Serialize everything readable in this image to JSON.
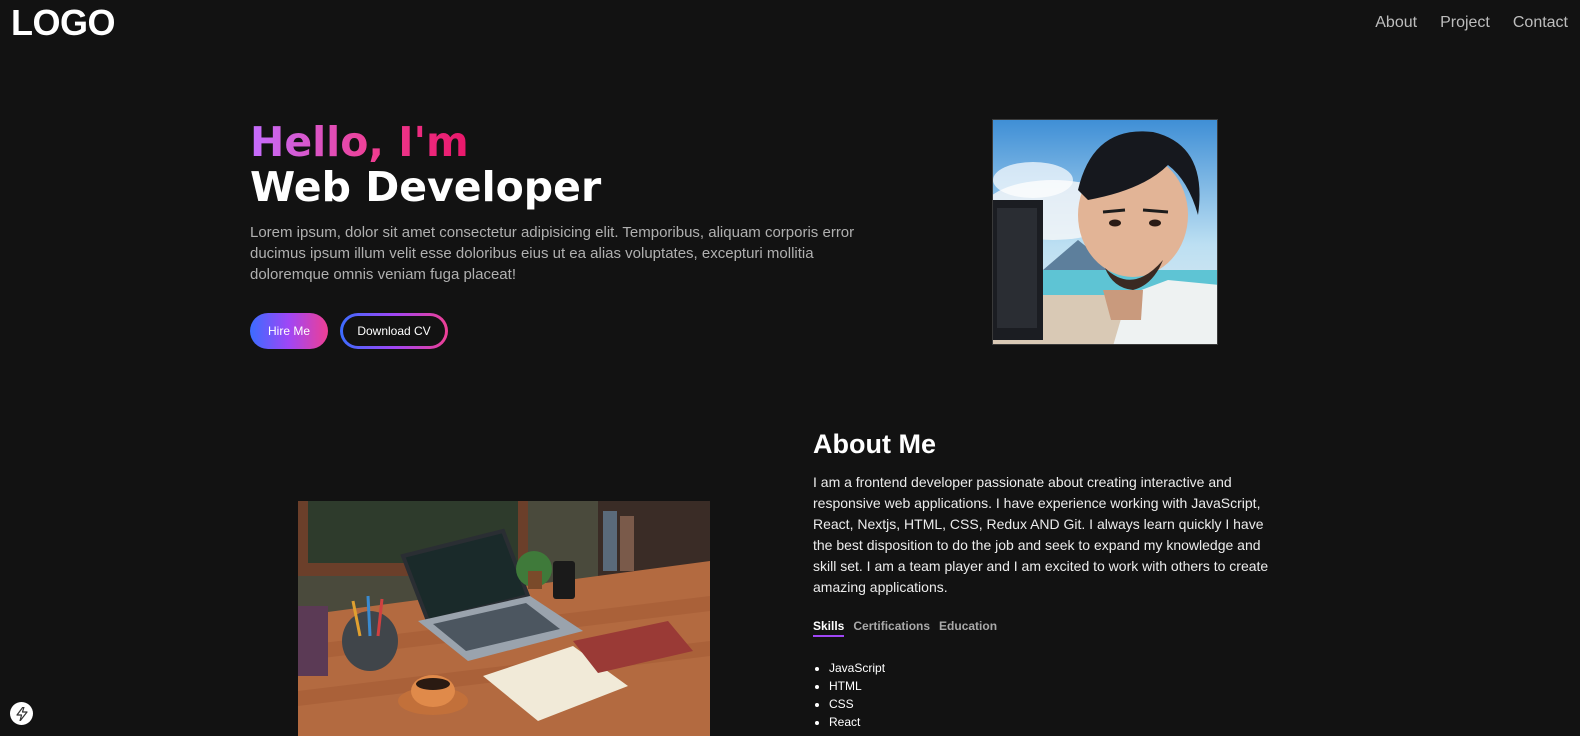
{
  "header": {
    "logo": "LOGO",
    "nav": [
      {
        "label": "About"
      },
      {
        "label": "Project"
      },
      {
        "label": "Contact"
      }
    ]
  },
  "hero": {
    "greeting": "Hello, I'm",
    "role": "Web Developer",
    "description": "Lorem ipsum, dolor sit amet consectetur adipisicing elit. Temporibus, aliquam corporis error ducimus ipsum illum velit esse doloribus eius ut ea alias voluptates, excepturi mollitia doloremque omnis veniam fuga placeat!",
    "hire_label": "Hire Me",
    "cv_label": "Download CV"
  },
  "about": {
    "title": "About Me",
    "text": "I am a frontend developer passionate about creating interactive and responsive web applications. I have experience working with JavaScript, React, Nextjs, HTML, CSS, Redux AND Git. I always learn quickly I have the best disposition to do the job and seek to expand my knowledge and skill set. I am a team player and I am excited to work with others to create amazing applications.",
    "tabs": [
      {
        "label": "Skills",
        "active": true
      },
      {
        "label": "Certifications",
        "active": false
      },
      {
        "label": "Education",
        "active": false
      }
    ],
    "skills": [
      "JavaScript",
      "HTML",
      "CSS",
      "React"
    ]
  },
  "colors": {
    "background": "#121212",
    "gradient_start": "#3b6cff",
    "gradient_mid": "#a046f5",
    "gradient_end": "#ee3f94"
  },
  "icons": {
    "portrait": "avatar-illustration",
    "desk": "desk-illustration",
    "badge": "lightning-icon"
  }
}
